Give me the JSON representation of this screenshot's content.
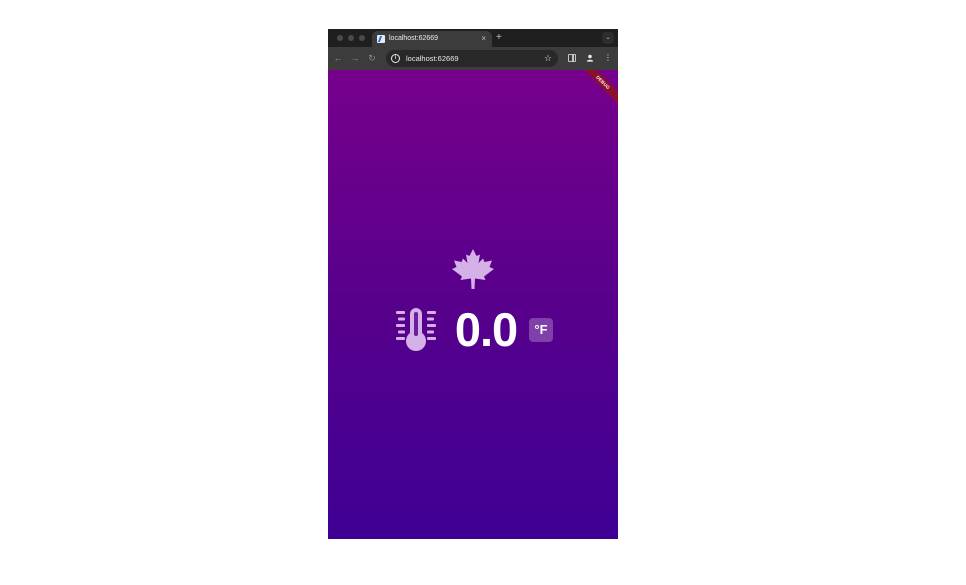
{
  "browser": {
    "tab_title": "localhost:62669",
    "tab_close": "×",
    "new_tab": "+",
    "tab_search": "⌄",
    "url": "localhost:62669",
    "star_icon": "star-icon",
    "back_glyph": "←",
    "forward_glyph": "→",
    "reload_glyph": "↻",
    "menu_glyph": "⋮"
  },
  "app": {
    "debug_banner": "DEBUG",
    "temperature_value": "0.0",
    "unit_label": "°F",
    "icons": [
      "maple-leaf-icon",
      "thermometer-icon"
    ],
    "colors": {
      "gradient_top": "#76008c",
      "gradient_bottom": "#3f0094",
      "icon_tint": "#d4b1e6",
      "debug_banner": "#8b0f2f"
    }
  }
}
